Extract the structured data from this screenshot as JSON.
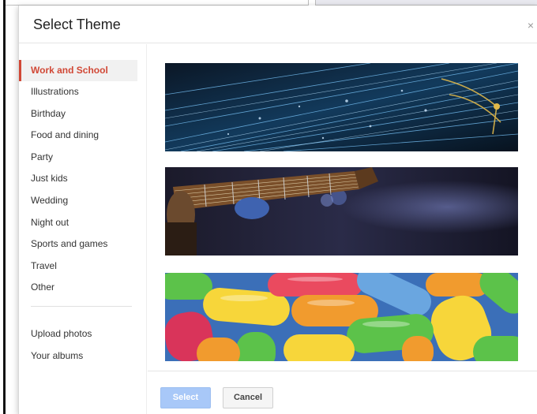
{
  "dialog": {
    "title": "Select Theme",
    "close_glyph": "×"
  },
  "sidebar": {
    "categories": [
      {
        "label": "Work and School",
        "active": true
      },
      {
        "label": "Illustrations"
      },
      {
        "label": "Birthday"
      },
      {
        "label": "Food and dining"
      },
      {
        "label": "Party"
      },
      {
        "label": "Just kids"
      },
      {
        "label": "Wedding"
      },
      {
        "label": "Night out"
      },
      {
        "label": "Sports and games"
      },
      {
        "label": "Travel"
      },
      {
        "label": "Other"
      }
    ],
    "sources": [
      {
        "label": "Upload photos"
      },
      {
        "label": "Your albums"
      }
    ]
  },
  "themes": [
    {
      "name": "fiber-optics-theme"
    },
    {
      "name": "guitar-theme"
    },
    {
      "name": "candy-theme"
    }
  ],
  "footer": {
    "select_label": "Select",
    "cancel_label": "Cancel"
  },
  "colors": {
    "accent": "#d14836",
    "primary_disabled": "#a8c8f8"
  }
}
